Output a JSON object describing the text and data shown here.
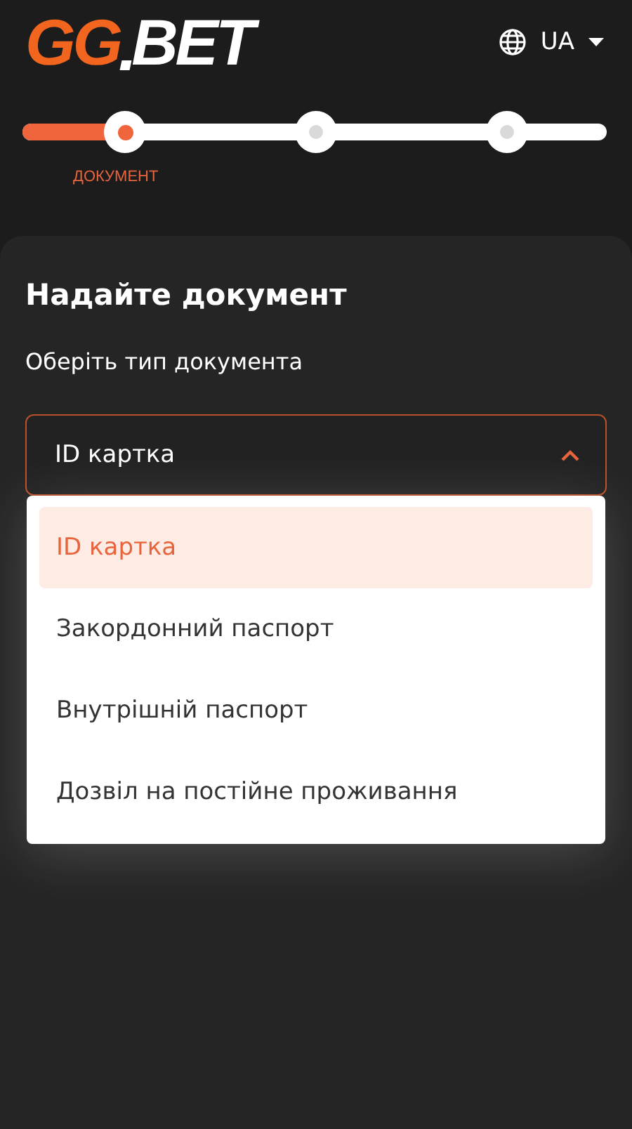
{
  "logo": {
    "accent": "GG",
    "main": "BET"
  },
  "language": {
    "code": "UA"
  },
  "stepper": {
    "level": 0.17,
    "steps": [
      {
        "label": "ДОКУМЕНТ",
        "selected": true
      },
      {
        "selected": false
      },
      {
        "selected": false
      }
    ]
  },
  "card": {
    "title": "Надайте документ",
    "label": "Оберіть тип документа",
    "select": {
      "value": "ID картка",
      "expanded": true,
      "options": [
        {
          "label": "ID картка",
          "selected": true
        },
        {
          "label": "Закордонний паспорт",
          "selected": false
        },
        {
          "label": "Внутрішній паспорт",
          "selected": false
        },
        {
          "label": "Дозвіл на постійне проживання",
          "selected": false
        }
      ]
    }
  }
}
